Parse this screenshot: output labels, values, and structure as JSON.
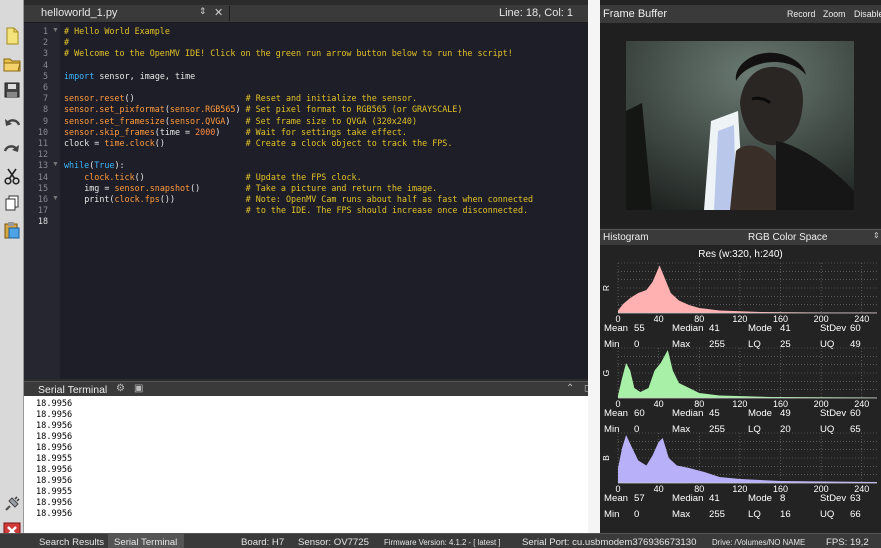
{
  "editor": {
    "tab_title": "helloworld_1.py",
    "tab_arrows": "⇕",
    "tab_close": "✕",
    "line_col": "Line: 18, Col: 1",
    "line_numbers": [
      "1",
      "2",
      "3",
      "4",
      "5",
      "6",
      "7",
      "8",
      "9",
      "10",
      "11",
      "12",
      "13",
      "14",
      "15",
      "16",
      "17",
      "18"
    ],
    "lines": [
      "# Hello World Example",
      "#",
      "# Welcome to the OpenMV IDE! Click on the green run arrow button below to run the script!",
      "",
      "import sensor, image, time",
      "",
      "sensor.reset()                      # Reset and initialize the sensor.",
      "sensor.set_pixformat(sensor.RGB565) # Set pixel format to RGB565 (or GRAYSCALE)",
      "sensor.set_framesize(sensor.QVGA)   # Set frame size to QVGA (320x240)",
      "sensor.skip_frames(time = 2000)     # Wait for settings take effect.",
      "clock = time.clock()                # Create a clock object to track the FPS.",
      "",
      "while(True):",
      "    clock.tick()                    # Update the FPS clock.",
      "    img = sensor.snapshot()         # Take a picture and return the image.",
      "    print(clock.fps())              # Note: OpenMV Cam runs about half as fast when connected",
      "                                    # to the IDE. The FPS should increase once disconnected.",
      ""
    ]
  },
  "terminal": {
    "title": "Serial Terminal",
    "lines": [
      "18.9956",
      "18.9956",
      "18.9956",
      "18.9956",
      "18.9956",
      "18.9955",
      "18.9956",
      "18.9956",
      "18.9955",
      "18.9956",
      "18.9956"
    ]
  },
  "status": {
    "search_results": "Search Results",
    "serial_terminal": "Serial Terminal",
    "board": "Board: H7",
    "sensor": "Sensor: OV7725",
    "firmware": "Firmware Version: 4.1.2 - [ latest ]",
    "serial_port": "Serial Port: cu.usbmodem376936673130",
    "drive": "Drive: /Volumes/NO NAME",
    "fps": "FPS: 19,2"
  },
  "frame_buffer": {
    "title": "Frame Buffer",
    "record": "Record",
    "zoom": "Zoom",
    "disable": "Disable"
  },
  "histogram": {
    "title": "Histogram",
    "color_space": "RGB Color Space",
    "resolution": "Res (w:320, h:240)",
    "x_ticks": [
      "0",
      "40",
      "80",
      "120",
      "160",
      "200",
      "240"
    ],
    "stat_labels": {
      "mean": "Mean",
      "median": "Median",
      "mode": "Mode",
      "stdev": "StDev",
      "min": "Min",
      "max": "Max",
      "lq": "LQ",
      "uq": "UQ"
    },
    "channels": [
      {
        "label": "R",
        "color": "#ffb0b0",
        "mean": "55",
        "median": "41",
        "mode": "41",
        "stdev": "60",
        "min": "0",
        "max": "255",
        "lq": "25",
        "uq": "49"
      },
      {
        "label": "G",
        "color": "#a8f0a8",
        "mean": "60",
        "median": "45",
        "mode": "49",
        "stdev": "60",
        "min": "0",
        "max": "255",
        "lq": "20",
        "uq": "65"
      },
      {
        "label": "B",
        "color": "#b8b0f8",
        "mean": "57",
        "median": "41",
        "mode": "8",
        "stdev": "63",
        "min": "0",
        "max": "255",
        "lq": "16",
        "uq": "66"
      }
    ]
  }
}
